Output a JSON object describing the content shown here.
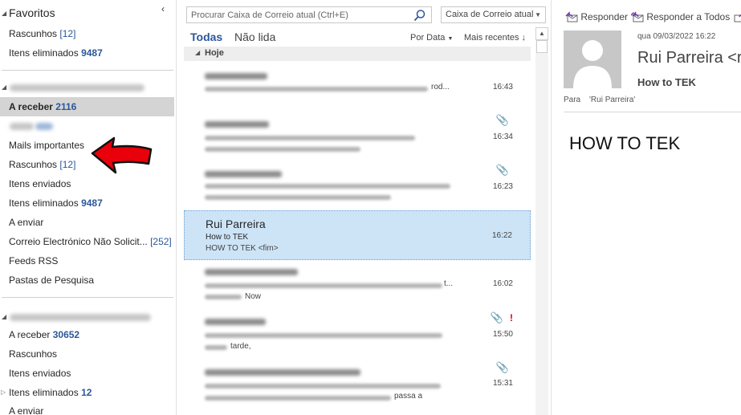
{
  "favorites": {
    "title": "Favoritos",
    "items": [
      {
        "label": "Rascunhos",
        "count": "[12]"
      },
      {
        "label": "Itens eliminados",
        "count": "9487"
      }
    ]
  },
  "account1": {
    "folders": [
      {
        "label": "A receber",
        "count": "2116"
      },
      {
        "label": "Mails importantes",
        "count": ""
      },
      {
        "label": "Rascunhos",
        "count": "[12]"
      },
      {
        "label": "Itens enviados",
        "count": ""
      },
      {
        "label": "Itens eliminados",
        "count": "9487"
      },
      {
        "label": "A enviar",
        "count": ""
      },
      {
        "label": "Correio Electrónico Não Solicit...",
        "count": "[252]"
      },
      {
        "label": "Feeds RSS",
        "count": ""
      },
      {
        "label": "Pastas de Pesquisa",
        "count": ""
      }
    ]
  },
  "account2": {
    "folders": [
      {
        "label": "A receber",
        "count": "30652"
      },
      {
        "label": "Rascunhos",
        "count": ""
      },
      {
        "label": "Itens enviados",
        "count": ""
      },
      {
        "label": "Itens eliminados",
        "count": "12"
      },
      {
        "label": "A enviar",
        "count": ""
      }
    ]
  },
  "search": {
    "placeholder": "Procurar Caixa de Correio atual (Ctrl+E)",
    "scope": "Caixa de Correio atual"
  },
  "list": {
    "tab_all": "Todas",
    "tab_unread": "Não lida",
    "sort_by": "Por Data",
    "sort_order": "Mais recentes",
    "group_today": "Hoje",
    "messages": [
      {
        "time": "16:43",
        "subject_tail": "rod...",
        "preview_tail": ""
      },
      {
        "time": "16:34",
        "subject_tail": "",
        "preview_tail": ""
      },
      {
        "time": "16:23",
        "subject_tail": "",
        "preview_tail": ""
      },
      {
        "sender": "Rui Parreira",
        "subject": "How to TEK",
        "preview": "HOW TO TEK <fim>",
        "time": "16:22"
      },
      {
        "time": "16:02",
        "subject_tail": "t...",
        "preview_tail": "Now"
      },
      {
        "time": "15:50",
        "subject_tail": "",
        "preview_tail": "tarde,"
      },
      {
        "time": "15:31",
        "subject_tail": "",
        "preview_tail": "passa a"
      }
    ]
  },
  "reading": {
    "reply": "Responder",
    "reply_all": "Responder a Todos",
    "date": "qua 09/03/2022 16:22",
    "sender": "Rui Parreira <r",
    "subject": "How to TEK",
    "to_label": "Para",
    "to": "'Rui Parreira'",
    "body": "HOW TO TEK"
  },
  "colors": {
    "accent": "#2b579a",
    "selected_message": "#cde4f7",
    "selected_folder": "#d4d4d4",
    "attention_arrow": "#e8000b"
  }
}
